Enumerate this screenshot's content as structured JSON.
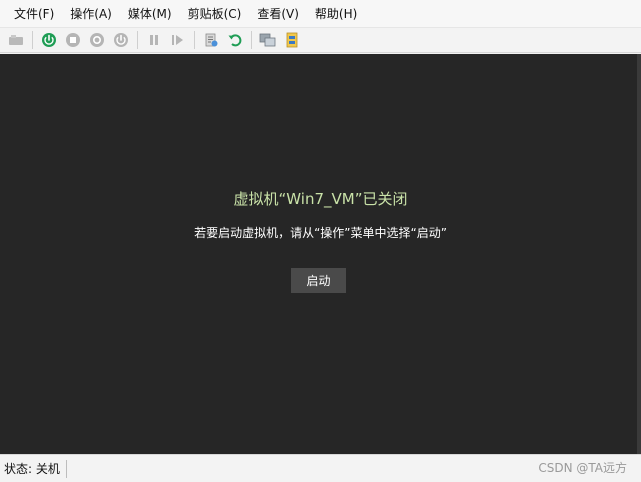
{
  "menubar": {
    "items": [
      "文件(F)",
      "操作(A)",
      "媒体(M)",
      "剪贴板(C)",
      "查看(V)",
      "帮助(H)"
    ]
  },
  "toolbar": {
    "icons": [
      "vm-settings-icon",
      "power-on-icon",
      "stop-icon",
      "shutdown-icon",
      "power-off-icon",
      "pause-icon",
      "resume-icon",
      "checkpoint-icon",
      "revert-icon",
      "enhanced-session-icon",
      "share-icon"
    ]
  },
  "vm": {
    "title": "虚拟机“Win7_VM”已关闭",
    "message": "若要启动虚拟机，请从“操作”菜单中选择“启动”",
    "start_button": "启动"
  },
  "status": {
    "text": "状态: 关机",
    "watermark": "CSDN @TA远方"
  },
  "colors": {
    "screen_bg": "#262626",
    "title_color": "#c9e2a8",
    "button_bg": "#4a4a4a"
  }
}
